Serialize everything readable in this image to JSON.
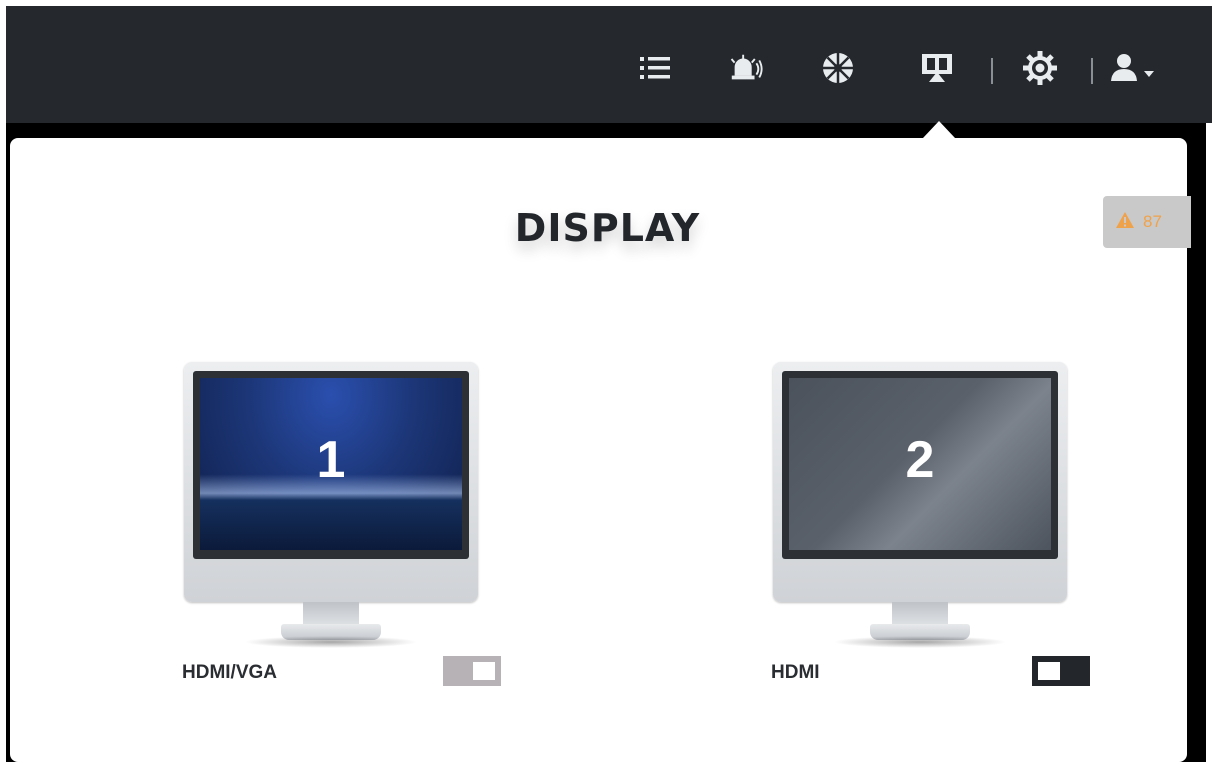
{
  "topbar": {
    "icons": [
      "list-icon",
      "alarm-icon",
      "aperture-icon",
      "display-icon",
      "gear-icon",
      "user-icon",
      "caret-down-icon"
    ]
  },
  "dialog": {
    "title": "DISPLAY"
  },
  "alert_badge": {
    "icon": "warning-icon",
    "count": "87",
    "color": "#f0a24a"
  },
  "displays": [
    {
      "number": "1",
      "label": "HDMI/VGA",
      "enabled": true
    },
    {
      "number": "2",
      "label": "HDMI",
      "enabled": false
    }
  ]
}
